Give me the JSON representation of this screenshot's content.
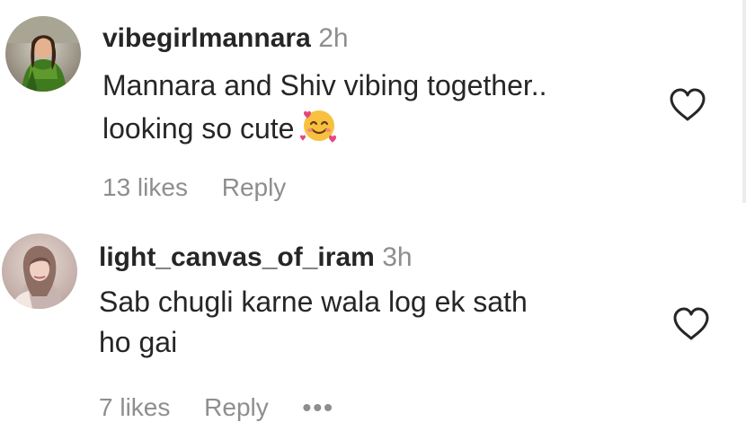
{
  "comments": [
    {
      "username": "vibegirlmannara",
      "time": "2h",
      "lines": [
        "Mannara and Shiv vibing together..",
        "looking so cute"
      ],
      "emoji": "smiling-face-with-hearts",
      "likes": "13 likes",
      "reply": "Reply"
    },
    {
      "username": "light_canvas_of_iram",
      "time": "3h",
      "lines": [
        "Sab chugli karne wala log ek sath",
        "ho gai"
      ],
      "likes": "7 likes",
      "reply": "Reply",
      "more": "•••"
    }
  ],
  "colors": {
    "text": "#262626",
    "secondary": "#8e8e8e"
  },
  "icons": [
    "avatar-photo",
    "heart-outline-icon",
    "smiling-face-with-hearts-emoji"
  ]
}
